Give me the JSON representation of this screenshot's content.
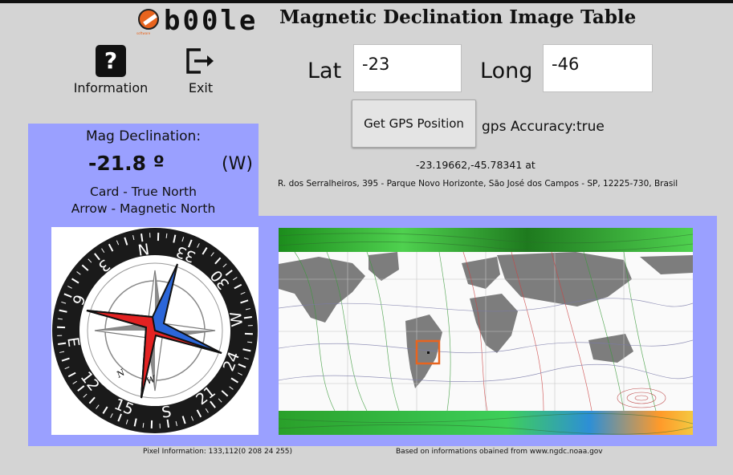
{
  "app": {
    "logo_text": "b00le",
    "logo_tagline": "software",
    "title": "Magnetic Declination Image Table"
  },
  "toolbar": {
    "info_label": "Information",
    "info_icon": "question-icon",
    "exit_label": "Exit",
    "exit_icon": "exit-icon"
  },
  "location": {
    "lat_label": "Lat",
    "lat_value": "-23",
    "long_label": "Long",
    "long_value": "-46",
    "gps_button": "Get GPS Position",
    "gps_accuracy": "gps Accuracy:true",
    "coords_text": "-23.19662,-45.78341 at",
    "address": "R. dos Serralheiros, 395 - Parque Novo Horizonte, São José dos Campos - SP, 12225-730, Brasil"
  },
  "declination": {
    "title": "Mag Declination:",
    "value": "-21.8 º",
    "direction": "(W)",
    "card_note": "Card - True North",
    "arrow_note": "Arrow - Magnetic North"
  },
  "compass": {
    "numbers": [
      "33",
      "30",
      "W",
      "24",
      "21",
      "S",
      "15",
      "12",
      "E",
      "6",
      "3",
      "N"
    ],
    "rose_labels": [
      "N",
      "W"
    ]
  },
  "footer": {
    "pixel_info": "Pixel Information: 133,112(0 208 24 255)",
    "source": "Based on informations obained from www.ngdc.noaa.gov"
  },
  "colors": {
    "panel_blue": "#9aa0ff",
    "background": "#d4d4d4",
    "arrow_blue": "#2b66d9",
    "arrow_red": "#e32222",
    "marker": "#e8641e"
  }
}
